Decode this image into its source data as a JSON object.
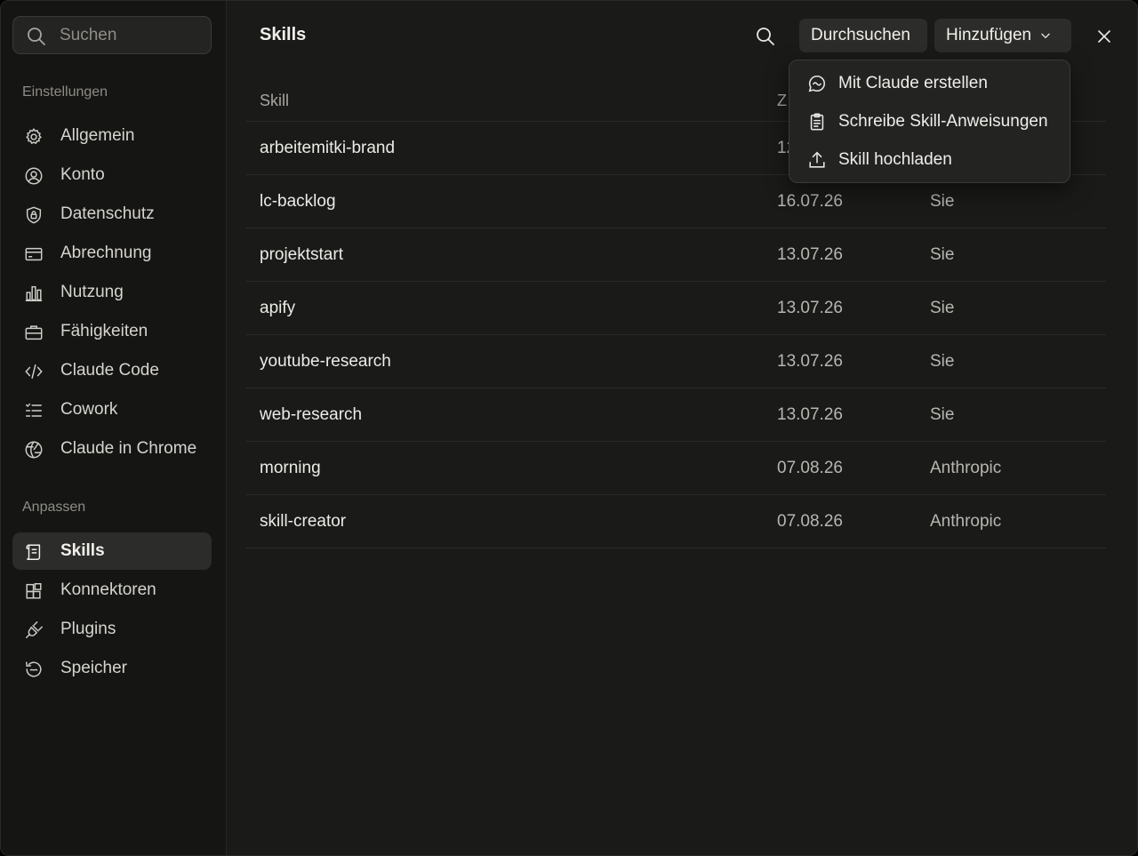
{
  "sidebar": {
    "search": {
      "placeholder": "Suchen",
      "icon": "search-icon"
    },
    "sections": [
      {
        "label": "Einstellungen"
      },
      {
        "label": "Anpassen"
      }
    ],
    "settings_items": [
      {
        "label": "Allgemein",
        "icon": "gear-icon"
      },
      {
        "label": "Konto",
        "icon": "user-circle-icon"
      },
      {
        "label": "Datenschutz",
        "icon": "shield-lock-icon"
      },
      {
        "label": "Abrechnung",
        "icon": "credit-card-icon"
      },
      {
        "label": "Nutzung",
        "icon": "bar-chart-icon"
      },
      {
        "label": "Fähigkeiten",
        "icon": "briefcase-icon"
      },
      {
        "label": "Claude Code",
        "icon": "code-icon"
      },
      {
        "label": "Cowork",
        "icon": "checklist-icon"
      },
      {
        "label": "Claude in Chrome",
        "icon": "globe-icon"
      }
    ],
    "custom_items": [
      {
        "label": "Skills",
        "icon": "scroll-icon",
        "active": true
      },
      {
        "label": "Konnektoren",
        "icon": "blocks-icon"
      },
      {
        "label": "Plugins",
        "icon": "plug-icon"
      },
      {
        "label": "Speicher",
        "icon": "history-icon"
      }
    ]
  },
  "header": {
    "title": "Skills",
    "search_icon": "search-icon",
    "browse_label": "Durchsuchen",
    "add_label": "Hinzufügen",
    "add_icon": "chevron-down-icon",
    "close_icon": "close-icon"
  },
  "table": {
    "columns": [
      "Skill",
      "Z",
      ""
    ],
    "rows": [
      {
        "name": "arbeitemitki-brand",
        "date": "12",
        "by": ""
      },
      {
        "name": "lc-backlog",
        "date": "16.07.26",
        "by": "Sie"
      },
      {
        "name": "projektstart",
        "date": "13.07.26",
        "by": "Sie"
      },
      {
        "name": "apify",
        "date": "13.07.26",
        "by": "Sie"
      },
      {
        "name": "youtube-research",
        "date": "13.07.26",
        "by": "Sie"
      },
      {
        "name": "web-research",
        "date": "13.07.26",
        "by": "Sie"
      },
      {
        "name": "morning",
        "date": "07.08.26",
        "by": "Anthropic"
      },
      {
        "name": "skill-creator",
        "date": "07.08.26",
        "by": "Anthropic"
      }
    ]
  },
  "dropdown": {
    "items": [
      {
        "label": "Mit Claude erstellen",
        "icon": "chat-bubble-icon"
      },
      {
        "label": "Schreibe Skill-Anweisungen",
        "icon": "clipboard-icon"
      },
      {
        "label": "Skill hochladen",
        "icon": "upload-icon"
      }
    ]
  },
  "colors": {
    "background": "#1a1a19",
    "sidebar": "#151514",
    "active_item": "#2c2c2a",
    "text": "#e8e6e1",
    "muted": "#8e8c86"
  }
}
